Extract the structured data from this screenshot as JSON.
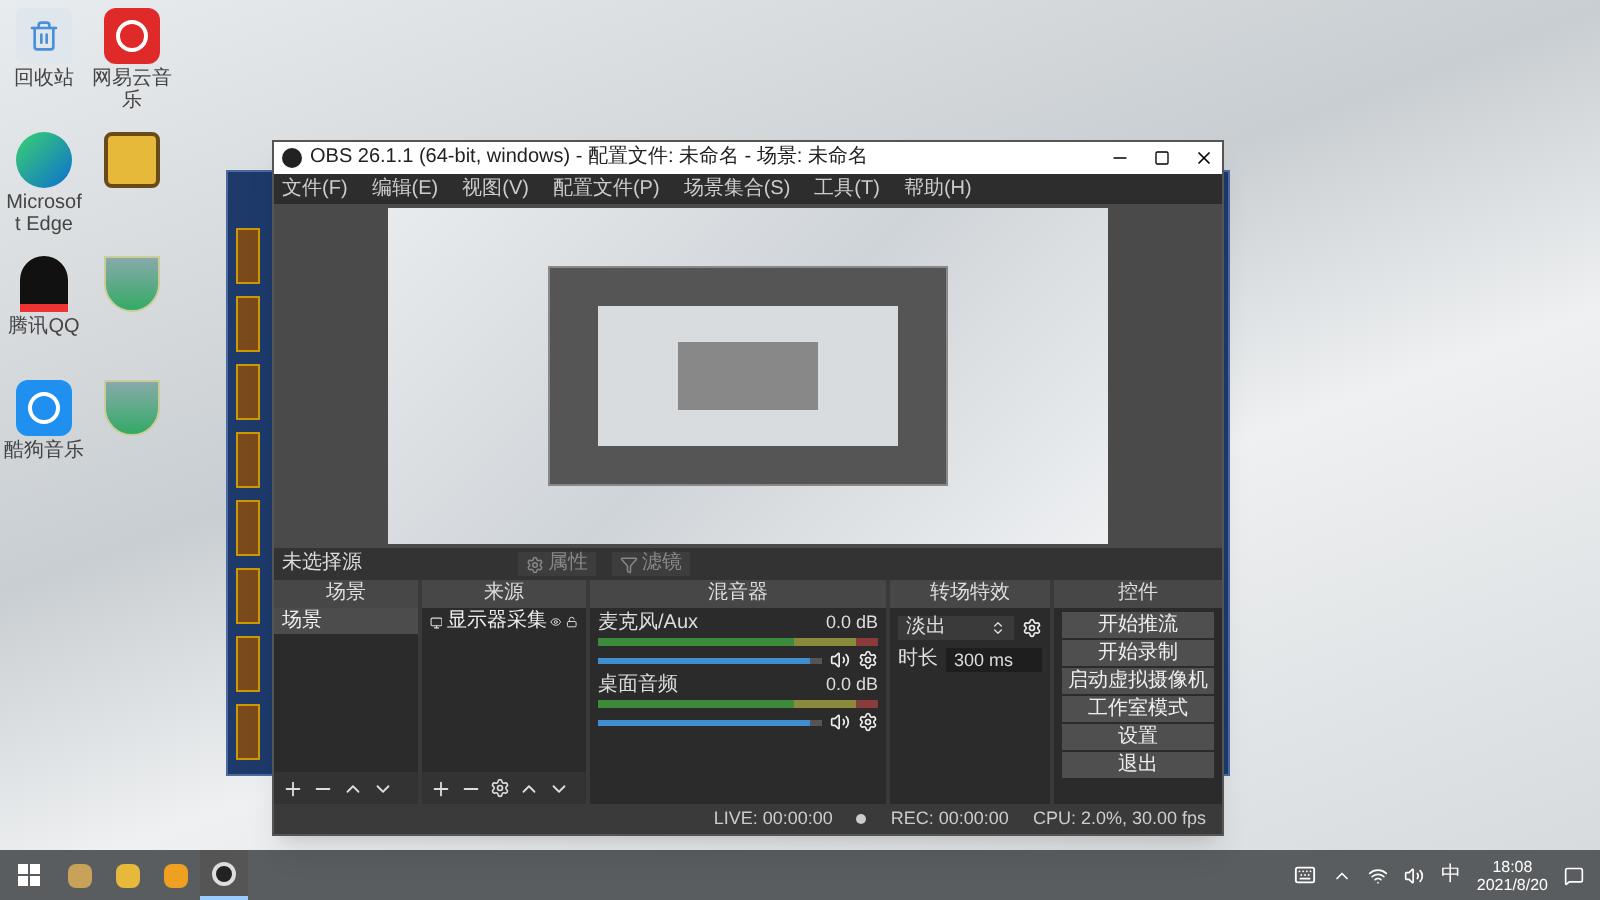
{
  "desktop_icons": [
    {
      "kind": "recycle",
      "label": "回收站"
    },
    {
      "kind": "music",
      "label": "网易云音乐"
    },
    {
      "kind": "edge",
      "label": "Microsoft Edge"
    },
    {
      "kind": "game"
    },
    {
      "kind": "penguin",
      "label": "腾讯QQ"
    },
    {
      "kind": "shield"
    },
    {
      "kind": "kugou",
      "label": "酷狗音乐"
    },
    {
      "kind": "shield"
    }
  ],
  "obs": {
    "title": "OBS 26.1.1 (64-bit, windows) - 配置文件: 未命名 - 场景: 未命名",
    "menu": [
      "文件(F)",
      "编辑(E)",
      "视图(V)",
      "配置文件(P)",
      "场景集合(S)",
      "工具(T)",
      "帮助(H)"
    ],
    "source_bar": {
      "label": "未选择源",
      "buttons": [
        {
          "kind": "gear",
          "label": "属性",
          "disabled": true
        },
        {
          "kind": "filter",
          "label": "滤镜",
          "disabled": true
        }
      ]
    },
    "scenes": {
      "title": "场景",
      "items": [
        {
          "label": "场景",
          "selected": true
        }
      ]
    },
    "sources": {
      "title": "来源",
      "items": [
        {
          "label": "显示器采集",
          "visible": true,
          "locked": false
        }
      ]
    },
    "mixer": {
      "title": "混音器",
      "channels": [
        {
          "name": "麦克风/Aux",
          "reading": "0.0 dB",
          "level": 0.95,
          "muted": false
        },
        {
          "name": "桌面音频",
          "reading": "0.0 dB",
          "level": 0.95,
          "muted": false
        }
      ]
    },
    "transitions": {
      "title": "转场特效",
      "select": "淡出",
      "duration_label": "时长",
      "duration": "300 ms"
    },
    "controls": {
      "title": "控件",
      "buttons": [
        "开始推流",
        "开始录制",
        "启动虚拟摄像机",
        "工作室模式",
        "设置",
        "退出"
      ]
    },
    "status": {
      "live": "LIVE: 00:00:00",
      "rec": "REC: 00:00:00",
      "cpu": "CPU: 2.0%, 30.00 fps"
    }
  },
  "taskbar": {
    "apps": [
      {
        "kind": "game",
        "active": false
      },
      {
        "kind": "yellow",
        "active": false
      },
      {
        "kind": "note",
        "active": false
      },
      {
        "kind": "obs",
        "active": true
      }
    ],
    "ime": "中",
    "time": "18:08",
    "date": "2021/8/20"
  }
}
